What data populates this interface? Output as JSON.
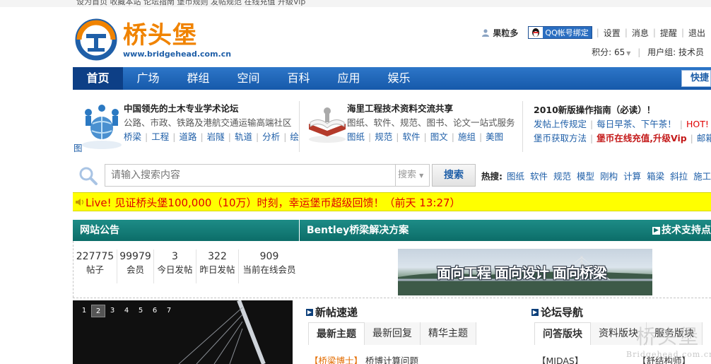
{
  "top_strip": "设为首页  收藏本站  论坛指南  堡币规则  发帖规范  在线充值  升级Vip",
  "logo": {
    "text": "桥头堡",
    "url": "www.bridgehead.com.cn"
  },
  "user": {
    "name": "果粒多",
    "qq_bind": "QQ帐号绑定",
    "links": [
      "设置",
      "消息",
      "提醒",
      "退出"
    ],
    "points_label": "积分: 65",
    "group_label": "用户组: 技术员"
  },
  "nav": {
    "items": [
      "首页",
      "广场",
      "群组",
      "空间",
      "百科",
      "应用",
      "娱乐"
    ],
    "active_index": 0,
    "quick": "快捷"
  },
  "intro": {
    "panel1": {
      "title": "中国领先的土木专业学术论坛",
      "line": "公路、市政、铁路及港航交通运输高端社区",
      "links": [
        "桥梁",
        "工程",
        "道路",
        "岩隧",
        "轨道",
        "分析",
        "绘"
      ],
      "overflow": "图"
    },
    "panel2": {
      "title": "海里工程技术资料交流共享",
      "line": "图纸、软件、规范、图书、论文一站式服务",
      "links": [
        "图纸",
        "规范",
        "软件",
        "图文",
        "施组",
        "美图"
      ]
    },
    "panel3": {
      "title": "2010新版操作指南（必读）！",
      "line1a": "发帖上传规定",
      "line1b": "每日早茶、下午茶！",
      "line1c": "HOT! 兴",
      "line2a": "堡币获取方法",
      "line2b": "堡币在线充值,升级Vip",
      "line2c": "邮箱"
    }
  },
  "search": {
    "placeholder": "请输入搜索内容",
    "type": "搜索",
    "button": "搜索",
    "hot_label": "热搜:",
    "hot": [
      "图纸",
      "软件",
      "规范",
      "模型",
      "刚构",
      "计算",
      "箱梁",
      "斜拉",
      "施工"
    ]
  },
  "live": "Live! 见证桥头堡100,000（10万）时刻，幸运堡币超级回馈！（前天 13:27）",
  "announcement": {
    "title": "网站公告",
    "stats": [
      {
        "num": "227775",
        "label": "帖子"
      },
      {
        "num": "99979",
        "label": "会员"
      },
      {
        "num": "3",
        "label": "今日发帖"
      },
      {
        "num": "322",
        "label": "昨日发帖"
      },
      {
        "num": "909",
        "label": "当前在线会员"
      }
    ]
  },
  "bentley": {
    "title": "Bentley桥梁解决方案",
    "support": "技术支持点",
    "banner_text": "面向工程  面向设计  面向桥梁"
  },
  "slider": {
    "pages": [
      "1",
      "2",
      "3",
      "4",
      "5",
      "6",
      "7"
    ],
    "active_index": 1
  },
  "new_posts": {
    "title": "新帖速递",
    "tabs": [
      "最新主题",
      "最新回复",
      "精华主题"
    ],
    "first_tag": "【桥梁博士】",
    "first_title": "桥博计算问题"
  },
  "forum_nav": {
    "title": "论坛导航",
    "tabs": [
      "问答版块",
      "资料版块",
      "服务版块"
    ],
    "row_a": "【MIDAS】",
    "row_b": "【舒结构师】"
  },
  "watermark": {
    "big": "桥头堡",
    "small": "Bridgehead.com.cn"
  },
  "colors": {
    "nav_blue": "#1659aa",
    "teal": "#0c6d69",
    "live_yellow": "#ffff00",
    "live_red": "#e00000",
    "logo_orange": "#f08300"
  }
}
